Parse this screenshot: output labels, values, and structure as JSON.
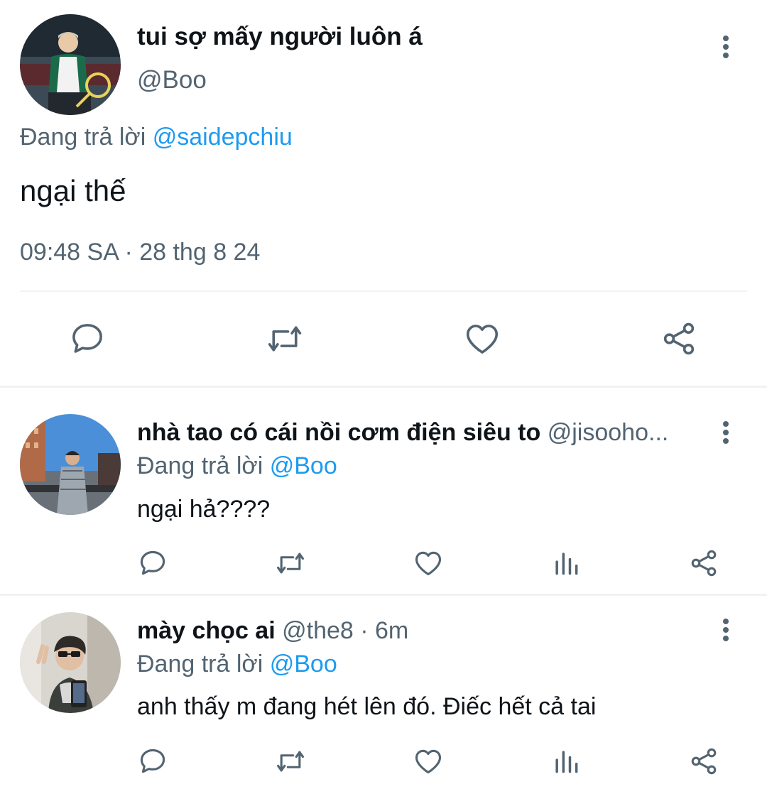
{
  "main_tweet": {
    "display_name": "tui sợ mấy người luôn á",
    "handle": "@Boo",
    "replying_label": "Đang trả lời",
    "replying_to": "@saidepchiu",
    "text": "ngại thế",
    "timestamp": "09:48 SA · 28 thg 8 24",
    "actions": [
      "reply-icon",
      "retweet-icon",
      "like-icon",
      "share-icon"
    ]
  },
  "replies": [
    {
      "display_name": "nhà tao có cái nồi cơm điện siêu to",
      "handle": "@jisooho...",
      "replying_label": "Đang trả lời",
      "replying_to": "@Boo",
      "text": "ngại hả????"
    },
    {
      "display_name": "mày chọc ai",
      "handle": "@the8 · 6m",
      "replying_label": "Đang trả lời",
      "replying_to": "@Boo",
      "text": "anh thấy m đang hét lên đó. Điếc hết cả tai"
    }
  ],
  "colors": {
    "text": "#0f1419",
    "secondary": "#536471",
    "link": "#1d9bf0",
    "divider": "#eff3f4"
  }
}
